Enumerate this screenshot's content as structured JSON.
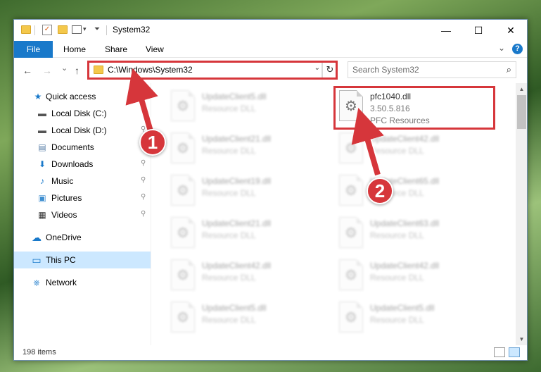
{
  "window": {
    "title": "System32",
    "minimize_glyph": "—",
    "maximize_glyph": "☐",
    "close_glyph": "✕"
  },
  "ribbon": {
    "tabs": [
      "File",
      "Home",
      "Share",
      "View"
    ],
    "help_glyph": "?",
    "collapse_glyph": "⌄"
  },
  "nav": {
    "back_glyph": "←",
    "forward_glyph": "→",
    "recent_glyph": "⌄",
    "up_glyph": "↑",
    "address": "C:\\Windows\\System32",
    "refresh_glyph": "↻",
    "search_placeholder": "Search System32"
  },
  "sidebar": {
    "items": [
      {
        "label": "Quick access",
        "icon": "star-icon",
        "glyph": "★"
      },
      {
        "label": "Local Disk (C:)",
        "icon": "drive-icon",
        "glyph": "▬"
      },
      {
        "label": "Local Disk (D:)",
        "icon": "drive-icon",
        "glyph": "▬"
      },
      {
        "label": "Documents",
        "icon": "documents-icon",
        "glyph": "▤"
      },
      {
        "label": "Downloads",
        "icon": "downloads-icon",
        "glyph": "⬇"
      },
      {
        "label": "Music",
        "icon": "music-icon",
        "glyph": "♪"
      },
      {
        "label": "Pictures",
        "icon": "pictures-icon",
        "glyph": "▣"
      },
      {
        "label": "Videos",
        "icon": "videos-icon",
        "glyph": "▦"
      },
      {
        "label": "OneDrive",
        "icon": "onedrive-icon",
        "glyph": "☁"
      },
      {
        "label": "This PC",
        "icon": "computer-icon",
        "glyph": "▭"
      },
      {
        "label": "Network",
        "icon": "network-icon",
        "glyph": "⎈"
      }
    ],
    "pin_glyph": "📌"
  },
  "files": {
    "highlighted": {
      "name": "pfc1040.dll",
      "version": "3.50.5.816",
      "description": "PFC Resources"
    },
    "left_column": [
      {
        "name": "UpdateClient5.dll",
        "type": "Resource DLL"
      },
      {
        "name": "UpdateClient21.dll",
        "type": "Resource DLL"
      },
      {
        "name": "UpdateClient19.dll",
        "type": "Resource DLL"
      },
      {
        "name": "UpdateClient21.dll",
        "type": "Resource DLL"
      },
      {
        "name": "UpdateClient42.dll",
        "type": "Resource DLL"
      },
      {
        "name": "UpdateClient5.dll",
        "type": "Resource DLL"
      }
    ],
    "right_column": [
      {
        "name": "UpdateClient42.dll",
        "type": "Resource DLL"
      },
      {
        "name": "UpdateClient65.dll",
        "type": "Resource DLL"
      },
      {
        "name": "UpdateClient63.dll",
        "type": "Resource DLL"
      },
      {
        "name": "UpdateClient42.dll",
        "type": "Resource DLL"
      },
      {
        "name": "UpdateClient5.dll",
        "type": "Resource DLL"
      }
    ],
    "gear_glyph": "⚙"
  },
  "status": {
    "item_count": "198 items"
  },
  "annotations": {
    "step1": "1",
    "step2": "2",
    "color": "#d6363b"
  },
  "colors": {
    "file_tab": "#1979ca",
    "selected_nav": "#cce8ff",
    "highlight": "#d6363b"
  }
}
